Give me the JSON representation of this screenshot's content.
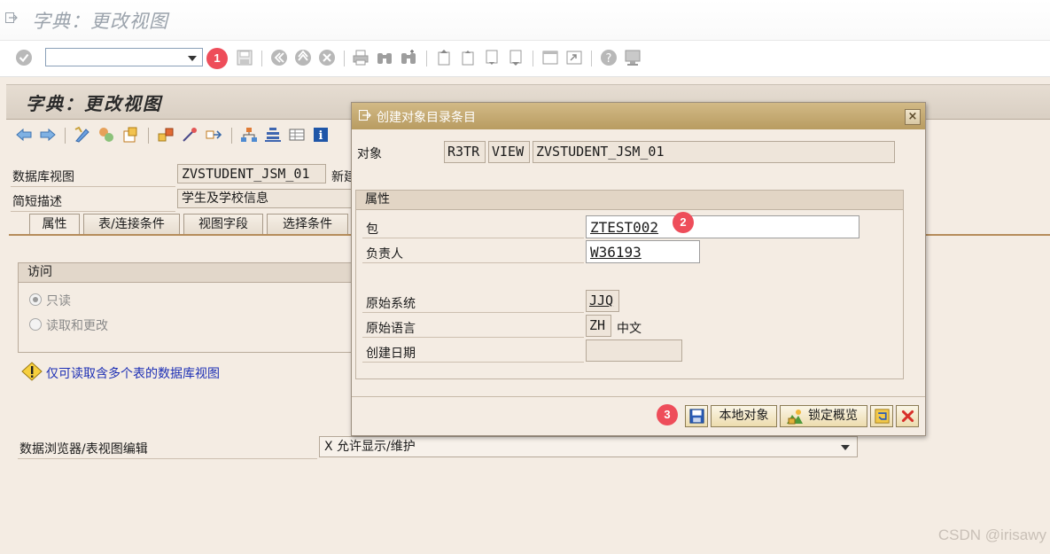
{
  "window": {
    "title": "字典：更改视图"
  },
  "system_toolbar": {
    "command_field": {
      "value": ""
    }
  },
  "badges": [
    "1",
    "2",
    "3"
  ],
  "screen": {
    "title": "字典：更改视图",
    "fields": {
      "db_view_label": "数据库视图",
      "db_view_value": "ZVSTUDENT_JSM_01",
      "db_view_status": "新建",
      "short_desc_label": "简短描述",
      "short_desc_value": "学生及学校信息"
    },
    "tabs": [
      "属性",
      "表/连接条件",
      "视图字段",
      "选择条件"
    ],
    "access_group": {
      "header": "访问",
      "options": [
        {
          "label": "只读",
          "selected": true
        },
        {
          "label": "读取和更改",
          "selected": false
        }
      ]
    },
    "warning_link": "仅可读取含多个表的数据库视图",
    "browser": {
      "label": "数据浏览器/表视图编辑",
      "value": "X 允许显示/维护"
    }
  },
  "dialog": {
    "title": "创建对象目录条目",
    "object_label": "对象",
    "object_values": [
      "R3TR",
      "VIEW",
      "ZVSTUDENT_JSM_01"
    ],
    "attributes_header": "属性",
    "package_label": "包",
    "package_value": "ZTEST002",
    "owner_label": "负责人",
    "owner_value": "W36193",
    "orig_system_label": "原始系统",
    "orig_system_value": "JJQ",
    "orig_lang_label": "原始语言",
    "orig_lang_code": "ZH",
    "orig_lang_name": "中文",
    "created_on_label": "创建日期",
    "created_on_value": "",
    "buttons": {
      "local_object": "本地对象",
      "lock_overview": "锁定概览"
    },
    "close_glyph": "×"
  },
  "watermark": "CSDN @irisawy"
}
